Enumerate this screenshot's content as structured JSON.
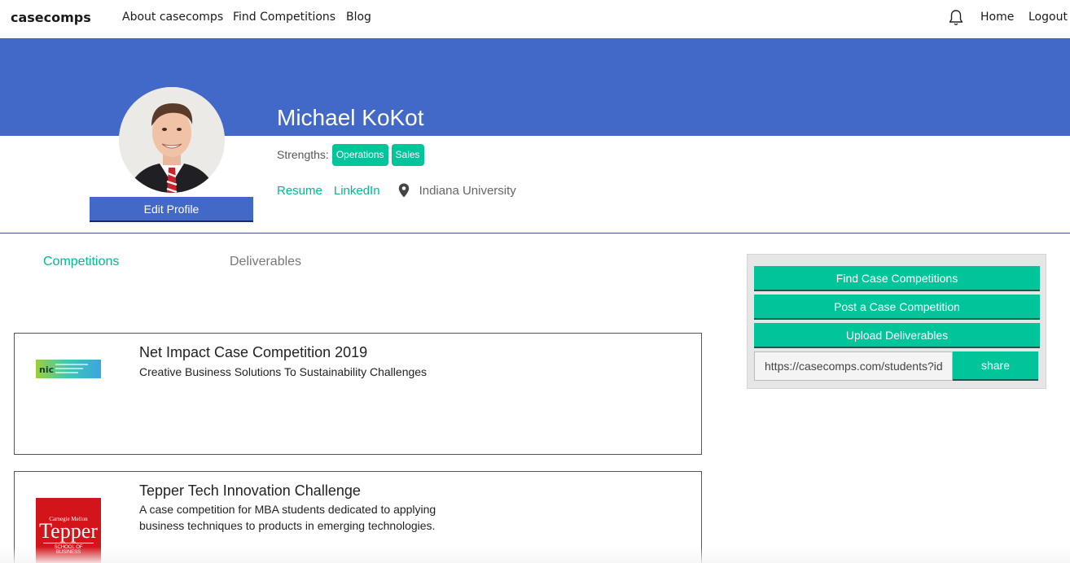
{
  "nav": {
    "brand": "casecomps",
    "links": [
      "About casecomps",
      "Find Competitions",
      "Blog"
    ],
    "home": "Home",
    "logout": "Logout",
    "bell_icon": "bell-icon"
  },
  "profile": {
    "name": "Michael KoKot",
    "edit_label": "Edit Profile",
    "strengths_label": "Strengths:",
    "strengths": [
      "Operations",
      "Sales"
    ],
    "resume": "Resume",
    "linkedin": "LinkedIn",
    "school": "Indiana University",
    "location_icon": "map-pin-icon"
  },
  "tabs": {
    "competitions": "Competitions",
    "deliverables": "Deliverables"
  },
  "competitions": [
    {
      "title": "Net Impact Case Competition 2019",
      "description": "Creative Business Solutions To Sustainability Challenges",
      "logo_text": "nic"
    },
    {
      "title": "Tepper Tech Innovation Challenge",
      "description": "A case competition for MBA students dedicated to applying business techniques to products in emerging technologies.",
      "logo_text": {
        "top": "Carnegie Mellon",
        "main": "Tepper",
        "bottom": "SCHOOL OF BUSINESS"
      }
    }
  ],
  "sidebar": {
    "find": "Find Case Competitions",
    "post": "Post a Case Competition",
    "upload": "Upload Deliverables",
    "share_url": "https://casecomps.com/students?id",
    "share": "share"
  },
  "colors": {
    "banner": "#4369c8",
    "accent": "#00c49a"
  }
}
